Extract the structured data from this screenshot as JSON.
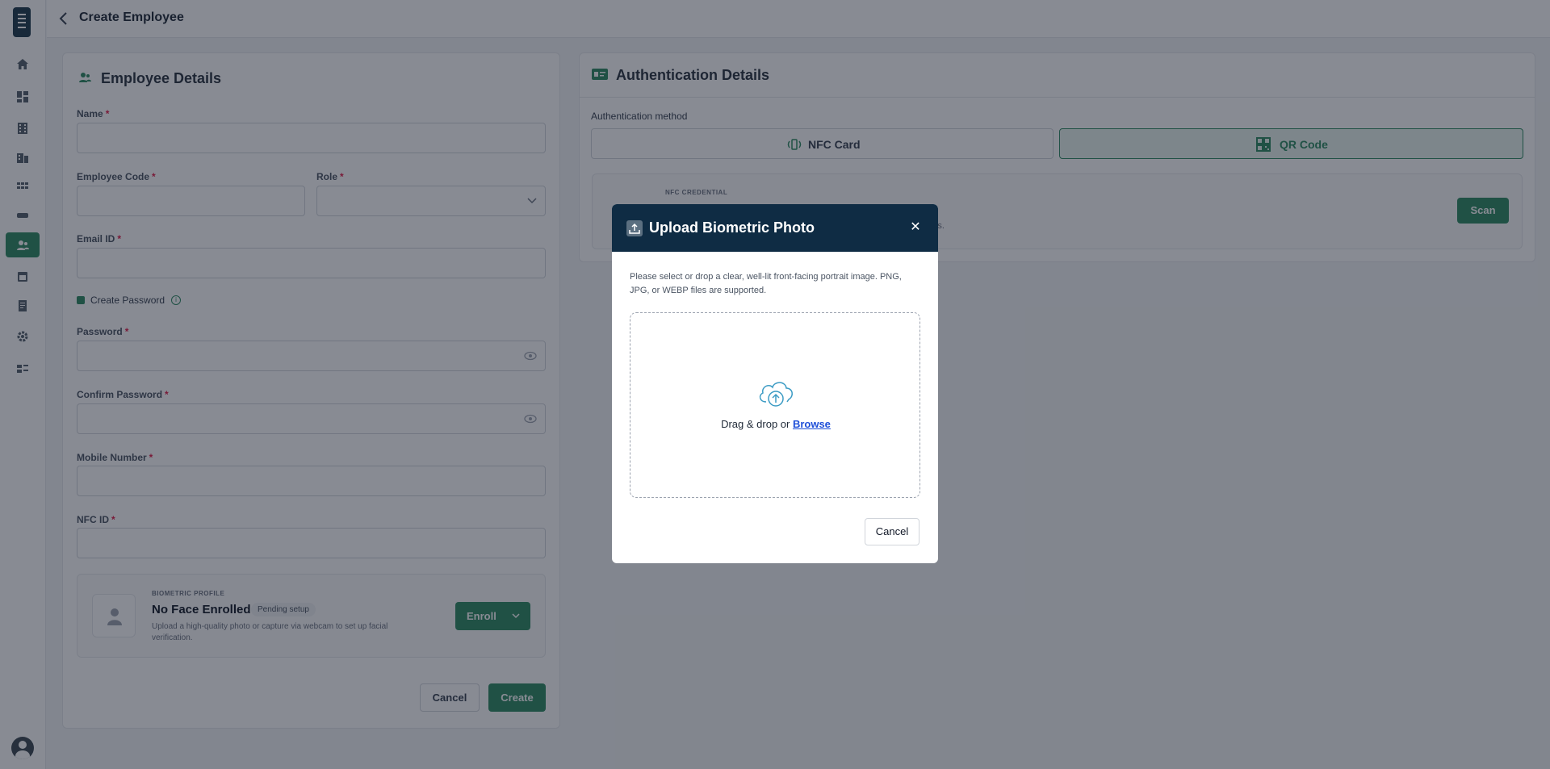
{
  "header": {
    "title": "Create Employee"
  },
  "employee_card": {
    "title": "Employee Details",
    "name_label": "Name",
    "code_label": "Employee Code",
    "role_label": "Role",
    "email_label": "Email ID",
    "create_password_label": "Create Password",
    "password_label": "Password",
    "confirm_password_label": "Confirm Password",
    "mobile_label": "Mobile Number",
    "nfc_label": "NFC ID",
    "required_mark": "*",
    "cancel_label": "Cancel",
    "create_label": "Create"
  },
  "biometric": {
    "kicker": "BIOMETRIC PROFILE",
    "title": "No Face Enrolled",
    "badge": "Pending setup",
    "description": "Upload a high-quality photo or capture via webcam to set up facial verification.",
    "enroll_label": "Enroll"
  },
  "auth_card": {
    "title": "Authentication Details",
    "method_label": "Authentication method",
    "options": [
      {
        "label": "NFC Card",
        "selected": false
      },
      {
        "label": "QR Code",
        "selected": true
      }
    ],
    "nfc_kicker": "NFC CREDENTIAL",
    "nfc_desc_tail": "dentials.",
    "scan_label": "Scan"
  },
  "modal": {
    "title": "Upload Biometric Photo",
    "description": "Please select or drop a clear, well-lit front-facing portrait image. PNG, JPG, or WEBP files are supported.",
    "drop_text": "Drag & drop or ",
    "browse_label": "Browse",
    "cancel_label": "Cancel"
  },
  "colors": {
    "accent": "#2e8b63",
    "modal_header": "#0f2c44",
    "sidebar_active": "#2e8b63"
  },
  "icons": {
    "sidebar": [
      "home-icon",
      "dashboard-icon",
      "building-icon",
      "office-icon",
      "grid-icon",
      "card-icon",
      "users-icon",
      "calendar-icon",
      "report-icon",
      "settings-icon",
      "layout-icon"
    ]
  }
}
